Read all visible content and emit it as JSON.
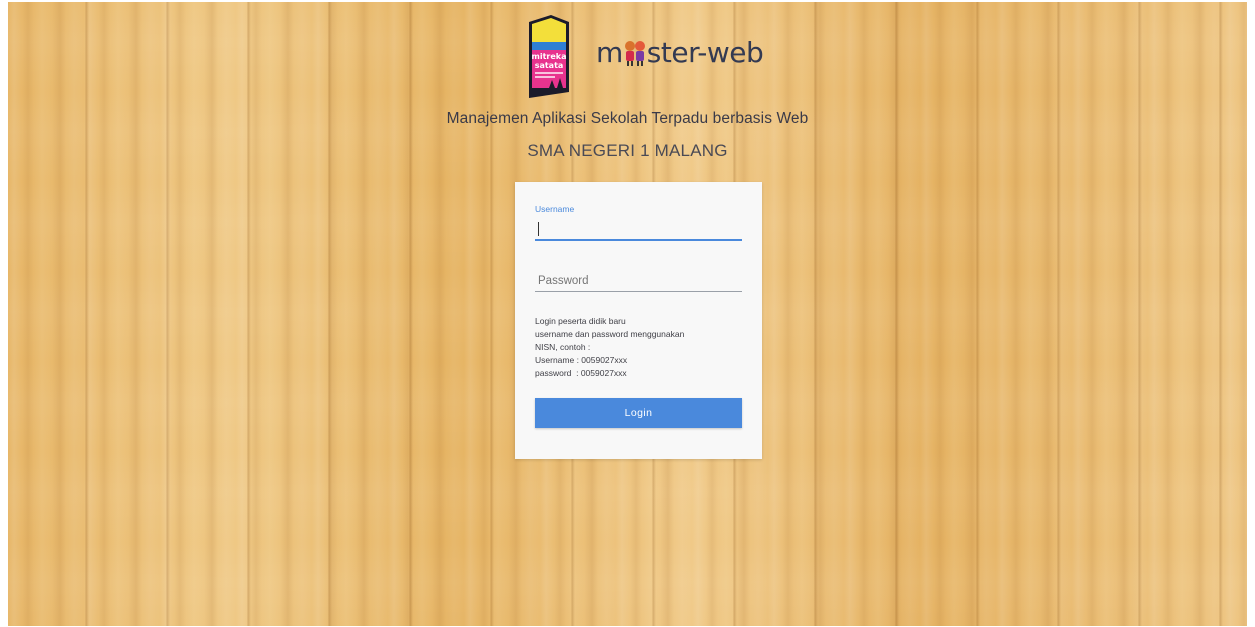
{
  "branding": {
    "badge_text_line1": "mitreka",
    "badge_text_line2": "satata",
    "brand_prefix": "m",
    "brand_suffix": "ster-web",
    "app_title": "Manajemen Aplikasi Sekolah Terpadu berbasis Web",
    "school_name": "SMA NEGERI 1 MALANG"
  },
  "login_form": {
    "username_label": "Username",
    "username_value": "",
    "password_placeholder": "Password",
    "password_value": "",
    "note_lines": [
      "Login peserta didik baru",
      "username dan password menggunakan",
      "NISN, contoh :",
      "Username : 0059027xxx",
      "password  : 0059027xxx"
    ],
    "login_button_label": "Login"
  },
  "colors": {
    "accent": "#4a89dc",
    "card_background": "#f8f8f8",
    "wood_base": "#e9bb6e"
  }
}
